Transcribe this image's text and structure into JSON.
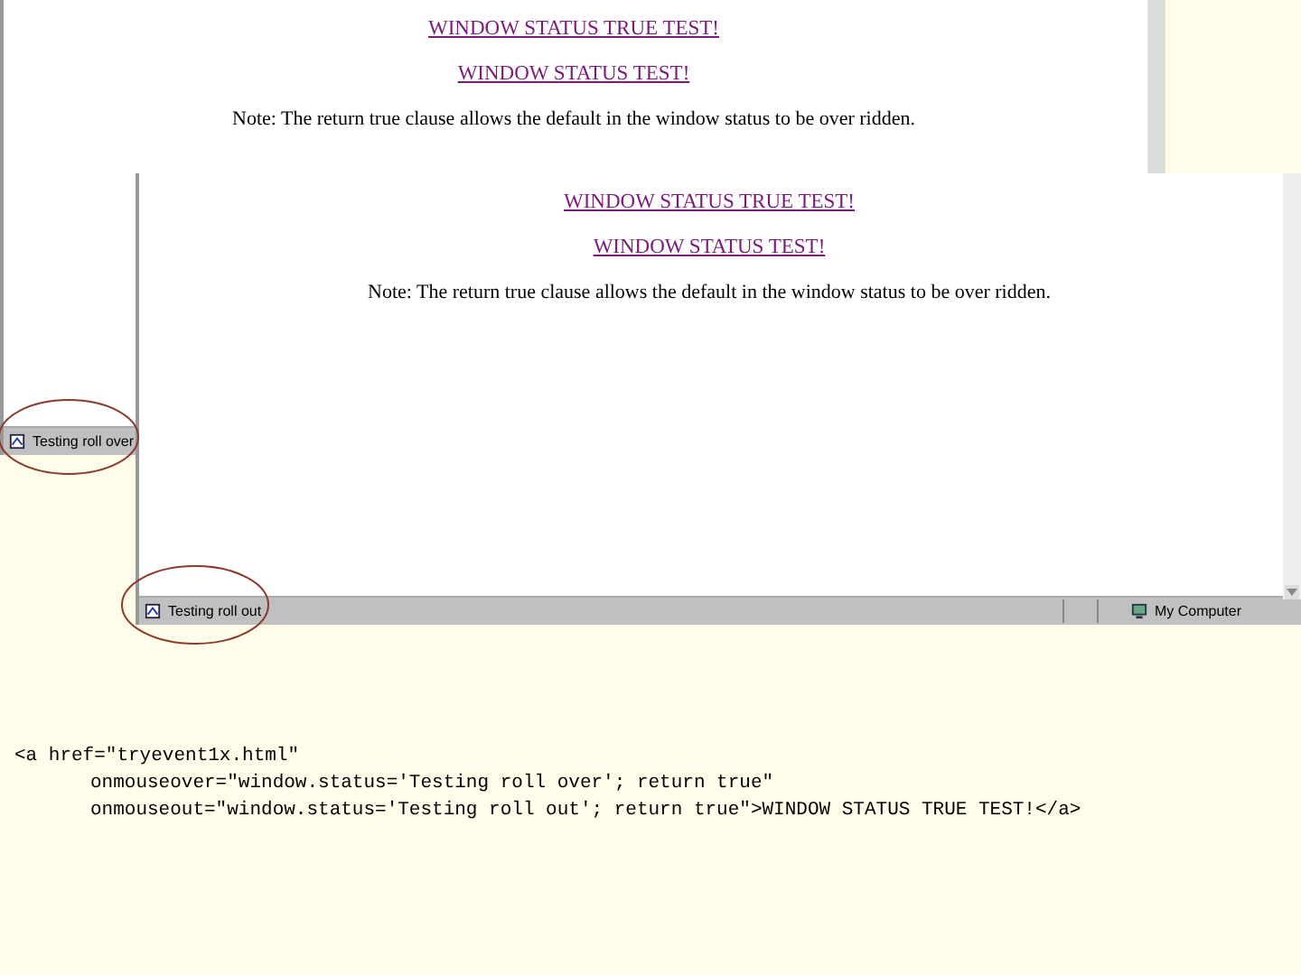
{
  "screenshots": [
    {
      "links": [
        "WINDOW STATUS TRUE TEST!",
        "WINDOW STATUS TEST!"
      ],
      "note": "Note: The return true clause allows the default in the window status to be over ridden.",
      "status_text": "Testing roll over"
    },
    {
      "links": [
        "WINDOW STATUS TRUE TEST!",
        "WINDOW STATUS TEST!"
      ],
      "note": "Note: The return true clause allows the default in the window status to be over ridden.",
      "status_text": "Testing roll out",
      "status_zone": "My Computer"
    }
  ],
  "code_lines": [
    "<a href=\"tryevent1x.html\"",
    "onmouseover=\"window.status='Testing roll over'; return true\"",
    "onmouseout=\"window.status='Testing roll out'; return true\">WINDOW STATUS TRUE TEST!</a>"
  ]
}
